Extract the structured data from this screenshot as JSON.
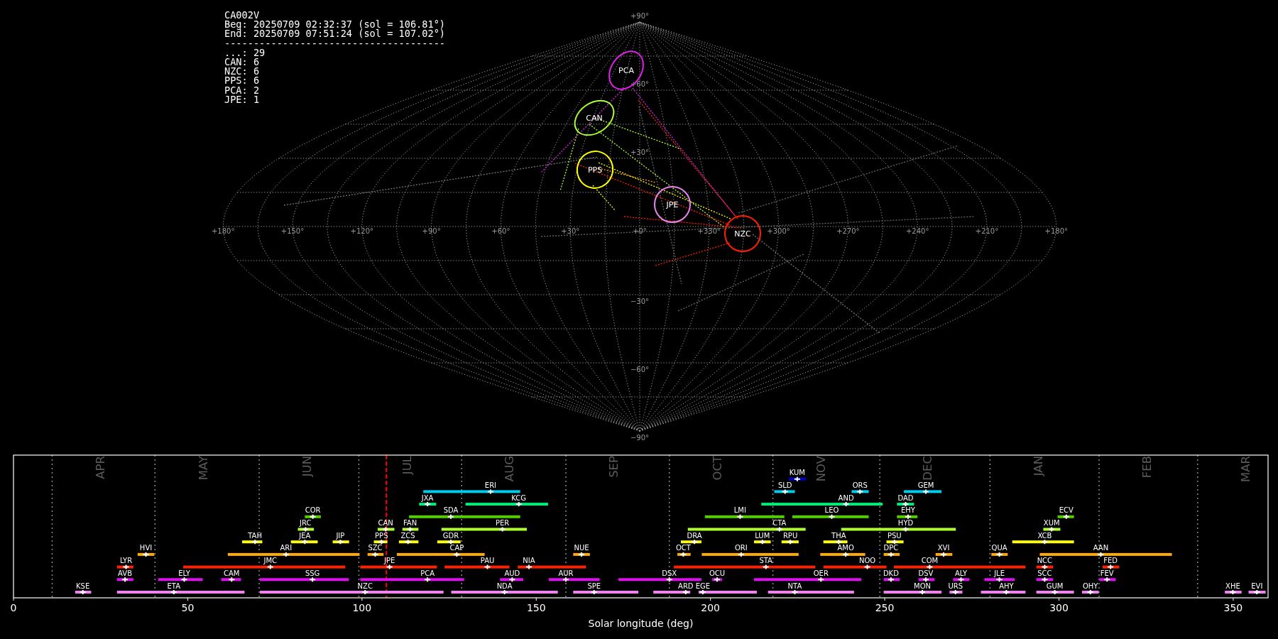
{
  "info": {
    "title": "CA002V",
    "lines": [
      "Beg: 20250709 02:32:37 (sol = 106.81°)",
      "End: 20250709 07:51:24 (sol = 107.02°)"
    ],
    "separator": "--------------------------------------",
    "counts": [
      "...: 29",
      "CAN: 6",
      "NZC: 6",
      "PPS: 6",
      "PCA: 2",
      "JPE: 1"
    ]
  },
  "sky_map": {
    "longitude_labels": [
      "+180°",
      "+150°",
      "+120°",
      "+90°",
      "+60°",
      "+30°",
      "+0°",
      "+330°",
      "+300°",
      "+270°",
      "+240°",
      "+210°",
      "+180°"
    ],
    "latitude_labels": [
      "+90°",
      "+60°",
      "+30°",
      "−30°",
      "−60°",
      "−90°"
    ],
    "radiants": [
      {
        "label": "PCA",
        "color": "#e020e8"
      },
      {
        "label": "CAN",
        "color": "#adff2f"
      },
      {
        "label": "PPS",
        "color": "#ffff00"
      },
      {
        "label": "JPE",
        "color": "#ee82ee"
      },
      {
        "label": "NZC",
        "color": "#ff2000"
      }
    ]
  },
  "timeline": {
    "month_labels": [
      "APR",
      "MAY",
      "JUN",
      "JUL",
      "AUG",
      "SEP",
      "OCT",
      "NOV",
      "DEC",
      "JAN",
      "FEB",
      "MAR"
    ],
    "tick_labels": [
      "0",
      "50",
      "100",
      "150",
      "200",
      "250",
      "300",
      "350"
    ],
    "xlabel": "Solar longitude (deg)",
    "rows": [
      {
        "color": "#0000cc",
        "bars": [
          "KUM"
        ]
      },
      {
        "color": "#00ccee",
        "bars": [
          "ERI",
          "SLD",
          "ORS",
          "GEM"
        ]
      },
      {
        "color": "#00ee77",
        "bars": [
          "JXA",
          "KCG",
          "AND",
          "DAD"
        ]
      },
      {
        "color": "#55cc00",
        "bars": [
          "COR",
          "SDA",
          "LMI",
          "LEO",
          "EHY",
          "ECV"
        ]
      },
      {
        "color": "#adff2f",
        "bars": [
          "JRC",
          "CAN",
          "FAN",
          "PER",
          "CTA",
          "HYD",
          "XUM"
        ]
      },
      {
        "color": "#ffff00",
        "bars": [
          "TAH",
          "JEA",
          "JIP",
          "PPS",
          "ZCS",
          "GDR",
          "DRA",
          "LUM",
          "RPU",
          "THA",
          "PSU",
          "XCB"
        ]
      },
      {
        "color": "#ffaa00",
        "bars": [
          "HVI",
          "ARI",
          "SZC",
          "CAP",
          "NUE",
          "OCT",
          "ORI",
          "AMO",
          "DPC",
          "XVI",
          "QUA",
          "AAN"
        ]
      },
      {
        "color": "#ff2200",
        "bars": [
          "LYR",
          "JMC",
          "JPE",
          "PAU",
          "NIA",
          "STA",
          "NOO",
          "COM",
          "NCC",
          "FED"
        ]
      },
      {
        "color": "#dd11ee",
        "bars": [
          "AVB",
          "ELY",
          "CAM",
          "SSG",
          "PCA",
          "AUD",
          "AUR",
          "DSX",
          "OCU",
          "OER",
          "DKD",
          "DSV",
          "ALY",
          "JLE",
          "SCC",
          "FEV"
        ]
      },
      {
        "color": "#ee82ee",
        "bars": [
          "KSE",
          "ETA",
          "NZC",
          "NDA",
          "SPE",
          "ARD",
          "EGE",
          "NTA",
          "MON",
          "URS",
          "AHY",
          "GUM",
          "OHY",
          "XHE",
          "EVI"
        ]
      }
    ]
  }
}
